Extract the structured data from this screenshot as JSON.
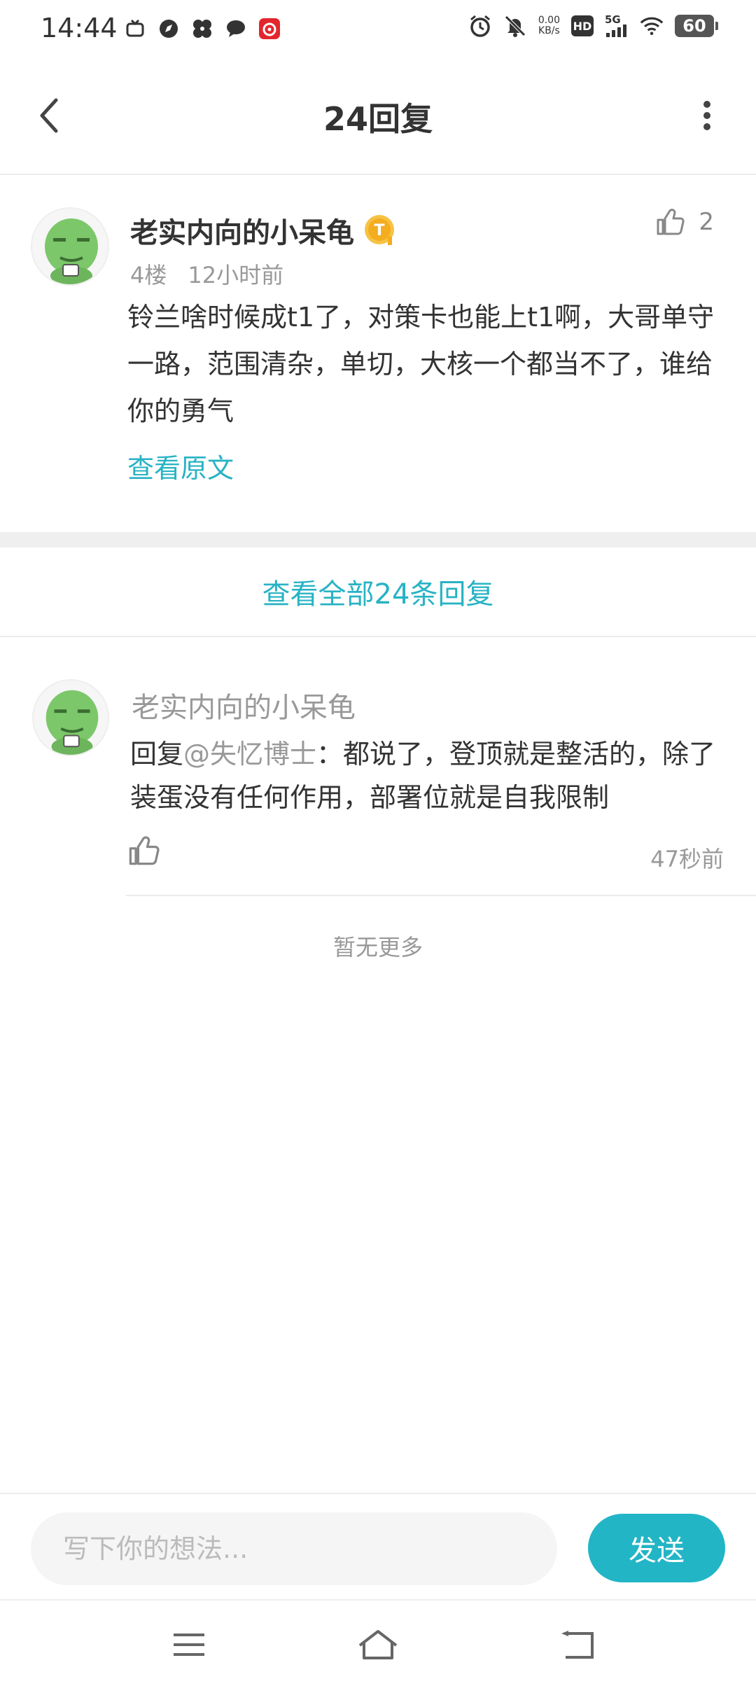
{
  "status_bar": {
    "time": "14:44",
    "net_speed_value": "0.00",
    "net_speed_unit": "KB/s",
    "hd": "HD",
    "signal": "5G",
    "battery": "60"
  },
  "header": {
    "title": "24回复"
  },
  "post": {
    "author": "老实内向的小呆龟",
    "like_count": "2",
    "floor": "4楼",
    "time": "12小时前",
    "content": "铃兰啥时候成t1了，对策卡也能上t1啊，大哥单守一路，范围清杂，单切，大核一个都当不了，谁给你的勇气",
    "view_original": "查看原文"
  },
  "view_all": "查看全部24条回复",
  "reply": {
    "author": "老实内向的小呆龟",
    "prefix": "回复",
    "mention": "@失忆博士",
    "text": "：都说了，登顶就是整活的，除了装蛋没有任何作用，部署位就是自我限制",
    "time": "47秒前"
  },
  "no_more": "暂无更多",
  "composer": {
    "placeholder": "写下你的想法...",
    "send_label": "发送"
  },
  "colors": {
    "accent": "#22b5c6",
    "link": "#27b3c4"
  }
}
